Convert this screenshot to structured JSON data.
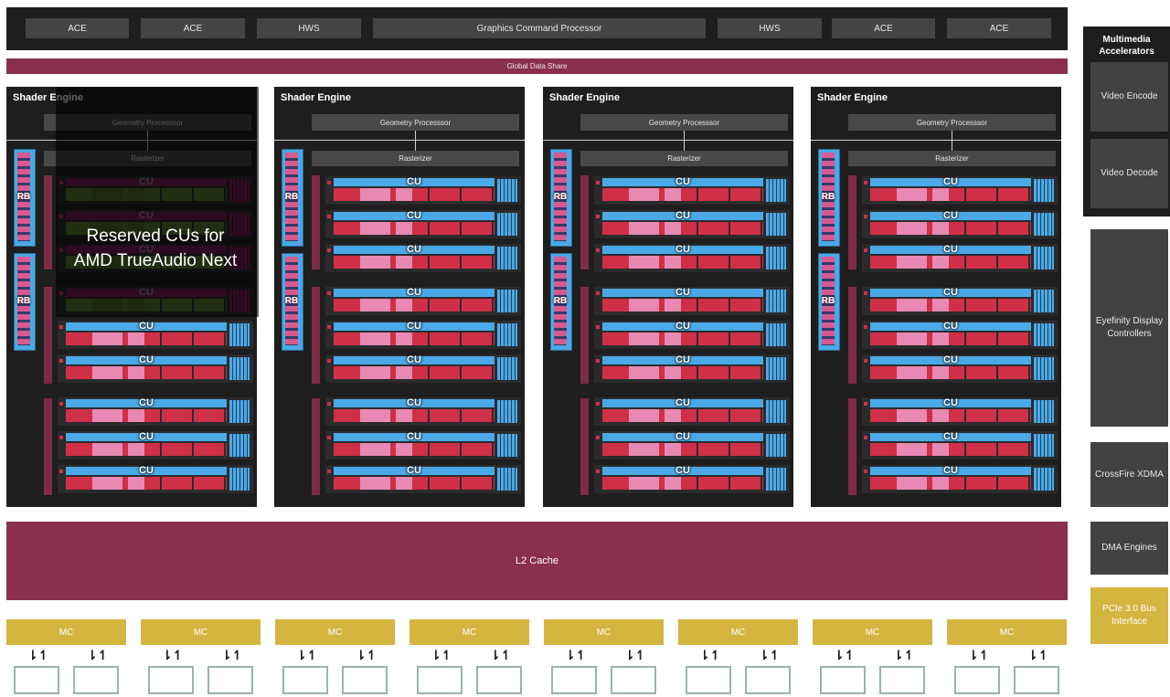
{
  "top_bar": {
    "blocks": [
      "ACE",
      "ACE",
      "HWS",
      "Graphics Command Processor",
      "HWS",
      "ACE",
      "ACE"
    ]
  },
  "global_data_share": "Global Data Share",
  "shader_engines": [
    {
      "title": "Shader Engine",
      "geometry": "Geometry Processsor",
      "rasterizer": "Rasterizer"
    },
    {
      "title": "Shader Engine",
      "geometry": "Geometry Processsor",
      "rasterizer": "Rasterizer"
    },
    {
      "title": "Shader Engine",
      "geometry": "Geometry Processsor",
      "rasterizer": "Rasterizer"
    },
    {
      "title": "Shader Engine",
      "geometry": "Geometry Processsor",
      "rasterizer": "Rasterizer"
    }
  ],
  "rb_label": "RB",
  "cu_label": "CU",
  "cu_count_per_engine": 9,
  "reserved_cu_count": 4,
  "reserved_overlay": {
    "line1": "Reserved CUs for",
    "line2": "AMD TrueAudio Next"
  },
  "l2_cache": "L2 Cache",
  "memory_controllers": [
    "MC",
    "MC",
    "MC",
    "MC",
    "MC",
    "MC",
    "MC",
    "MC"
  ],
  "arrow_glyph": "⇂↿",
  "right_column": {
    "multimedia_title": "Multimedia Accelerators",
    "video_encode": "Video Encode",
    "video_decode": "Video Decode",
    "eyefinity": "Eyefinity Display Controllers",
    "crossfire": "CrossFire XDMA",
    "dma": "DMA Engines",
    "pcie": "PCIe 3.0 Bus Interface"
  },
  "colors": {
    "dark_panel": "#1e1e1e",
    "block_gray": "#444446",
    "crimson": "#8a2f4e",
    "gold": "#d4b53f",
    "cu_blue": "#4aa9e6",
    "cu_red": "#cf3047",
    "cu_pink": "#e889b3"
  }
}
